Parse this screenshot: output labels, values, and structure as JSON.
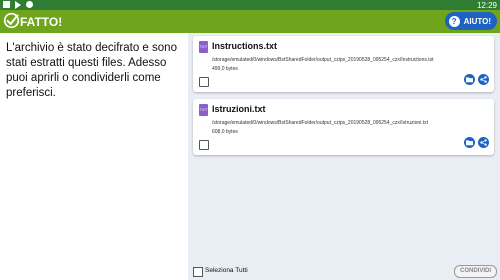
{
  "status_bar": {
    "time": "12:29"
  },
  "app_bar": {
    "title": "FATTO!",
    "help_label": "AIUTO!"
  },
  "message": "L'archivio  è stato decifrato e sono stati estratti questi files. Adesso puoi aprirli o condividerli come preferisci.",
  "files": [
    {
      "icon_label": "TXT",
      "name": "Instructions.txt",
      "path": "/storage/emulated/0/windows/BstSharedFolder/output_czips_20190528_095254_czx/Instructions.txt",
      "size": "499,0 bytes"
    },
    {
      "icon_label": "TXT",
      "name": "Istruzioni.txt",
      "path": "/storage/emulated/0/windows/BstSharedFolder/output_czips_20190528_095254_czx/Istruzioni.txt",
      "size": "608,0 bytes"
    }
  ],
  "footer": {
    "select_all_label": "Seleziona Tutti",
    "share_label": "CONDIVIDI"
  },
  "colors": {
    "status_bar": "#2e7d32",
    "app_bar": "#6fa51c",
    "accent_blue": "#1e63c2",
    "file_icon": "#8b5fc7"
  }
}
